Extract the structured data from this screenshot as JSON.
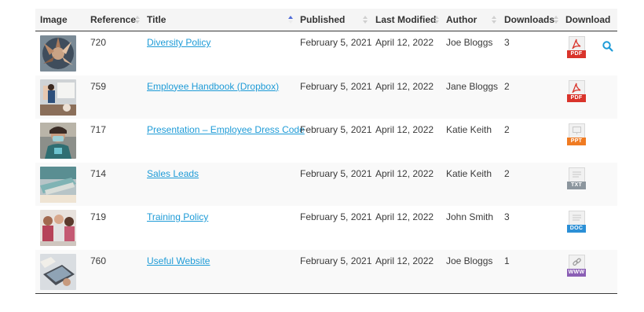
{
  "table": {
    "headers": {
      "image": "Image",
      "reference": "Reference",
      "title": "Title",
      "published": "Published",
      "last_modified": "Last Modified",
      "author": "Author",
      "downloads": "Downloads",
      "download": "Download"
    },
    "rows": [
      {
        "reference": "720",
        "title": "Diversity Policy",
        "published": "February 5, 2021",
        "last_modified": "April 12, 2022",
        "author": "Joe Bloggs",
        "downloads": "3",
        "file_type": "PDF",
        "image_icon": "team-hands-thumbnail",
        "file_icon": "pdf-file-icon"
      },
      {
        "reference": "759",
        "title": "Employee Handbook (Dropbox)",
        "published": "February 5, 2021",
        "last_modified": "April 12, 2022",
        "author": "Jane Bloggs",
        "downloads": "2",
        "file_type": "PDF",
        "image_icon": "presentation-thumbnail",
        "file_icon": "pdf-file-icon"
      },
      {
        "reference": "717",
        "title": "Presentation – Employee Dress Code",
        "published": "February 5, 2021",
        "last_modified": "April 12, 2022",
        "author": "Katie Keith",
        "downloads": "2",
        "file_type": "PPT",
        "image_icon": "person-mask-thumbnail",
        "file_icon": "ppt-file-icon"
      },
      {
        "reference": "714",
        "title": "Sales Leads",
        "published": "February 5, 2021",
        "last_modified": "April 12, 2022",
        "author": "Katie Keith",
        "downloads": "2",
        "file_type": "TXT",
        "image_icon": "stapler-thumbnail",
        "file_icon": "txt-file-icon"
      },
      {
        "reference": "719",
        "title": "Training Policy",
        "published": "February 5, 2021",
        "last_modified": "April 12, 2022",
        "author": "John Smith",
        "downloads": "3",
        "file_type": "DOC",
        "image_icon": "meeting-thumbnail",
        "file_icon": "doc-file-icon"
      },
      {
        "reference": "760",
        "title": "Useful Website",
        "published": "February 5, 2021",
        "last_modified": "April 12, 2022",
        "author": "Joe Bloggs",
        "downloads": "1",
        "file_type": "WWW",
        "image_icon": "laptop-thumbnail",
        "file_icon": "www-link-icon"
      }
    ]
  },
  "search_icon": "search-icon",
  "colors": {
    "link": "#1e9bd7",
    "pdf": "#d9342b",
    "ppt": "#f07b22",
    "txt": "#8c969e",
    "doc": "#2b8fd6",
    "www": "#8b5fb5",
    "header_bg": "#f5f5f5",
    "sort_active": "#4f6bd8"
  }
}
